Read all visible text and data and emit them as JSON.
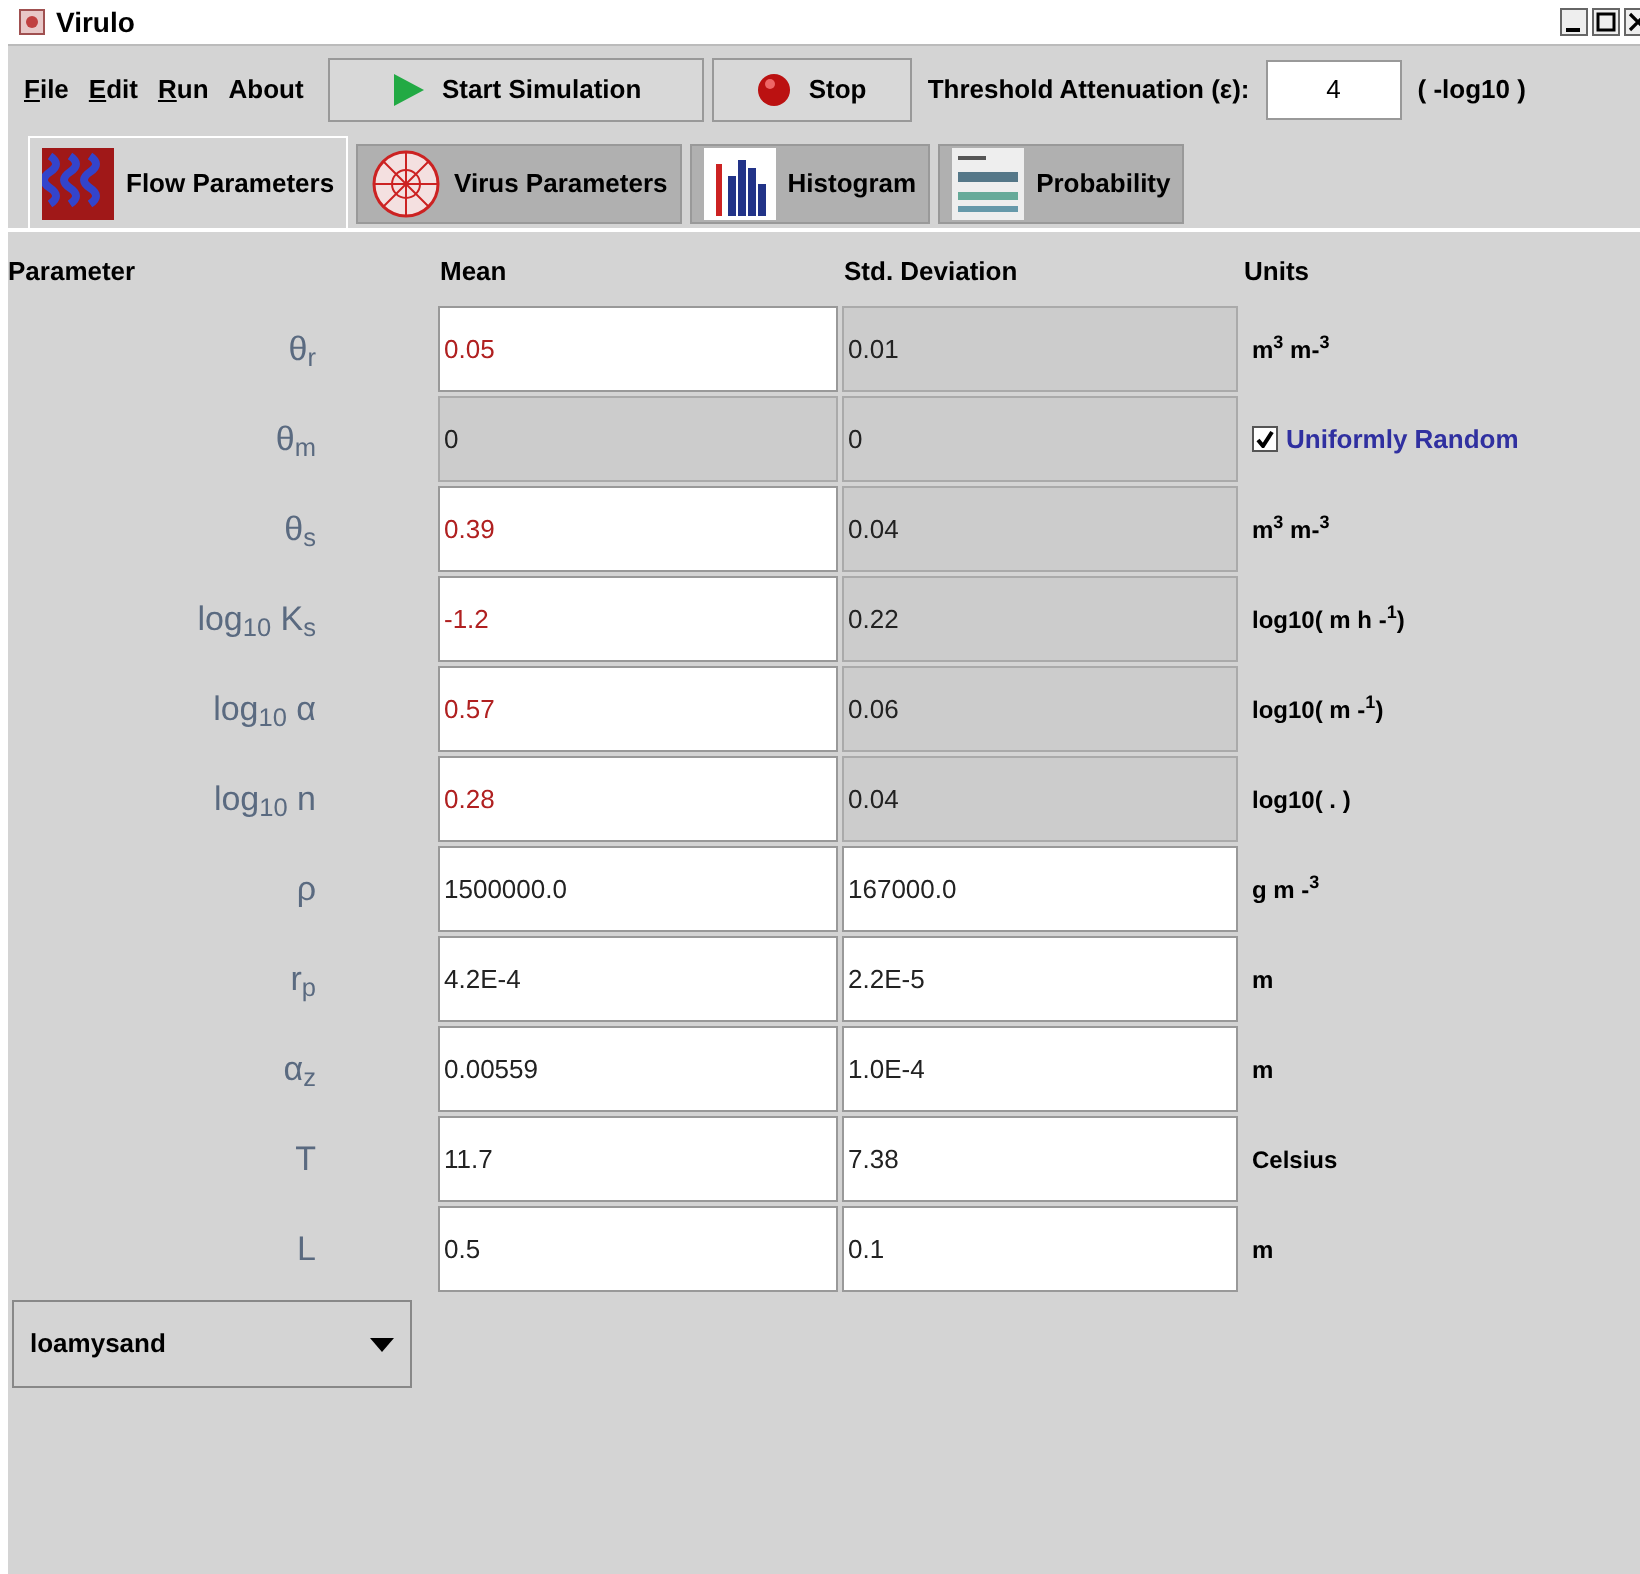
{
  "window": {
    "title": "Virulo"
  },
  "menu": [
    {
      "label": "File",
      "mnemonic": true
    },
    {
      "label": "Edit",
      "mnemonic": true
    },
    {
      "label": "Run",
      "mnemonic": true
    },
    {
      "label": "About",
      "mnemonic": false
    }
  ],
  "toolbar": {
    "start_button": "Start Simulation",
    "stop_button": "Stop",
    "threshold_label": "Threshold Attenuation (ε):",
    "threshold_value": "4",
    "threshold_unit": "( -log10 )"
  },
  "tabs": [
    {
      "label": "Flow Parameters",
      "selected": true,
      "kind": "waves"
    },
    {
      "label": "Virus Parameters",
      "selected": false,
      "kind": "virus"
    },
    {
      "label": "Histogram",
      "selected": false,
      "kind": "histogram"
    },
    {
      "label": "Probability",
      "selected": false,
      "kind": "table"
    }
  ],
  "table": {
    "columns": [
      "Parameter",
      "Mean",
      "Std. Deviation",
      "Units"
    ],
    "rows": [
      {
        "parameter": "θ$_{r}$",
        "mean": {
          "value": "0.05",
          "disabled": false,
          "highlighted": true
        },
        "std": {
          "value": "0.01",
          "disabled": true
        },
        "units": {
          "kind": "text",
          "text": "m$^{3}$ m-$^{3}$"
        }
      },
      {
        "parameter": "θ$_{m}$",
        "mean": {
          "value": "0",
          "disabled": true,
          "highlighted": false
        },
        "std": {
          "value": "0",
          "disabled": true
        },
        "units": {
          "kind": "checkbox",
          "text": "Uniformly Random",
          "checked": true
        }
      },
      {
        "parameter": "θ$_{s}$",
        "mean": {
          "value": "0.39",
          "disabled": false,
          "highlighted": true
        },
        "std": {
          "value": "0.04",
          "disabled": true
        },
        "units": {
          "kind": "text",
          "text": "m$^{3}$ m-$^{3}$"
        }
      },
      {
        "parameter": "log$_{10}$ K$_{s}$",
        "mean": {
          "value": "-1.2",
          "disabled": false,
          "highlighted": true
        },
        "std": {
          "value": "0.22",
          "disabled": true
        },
        "units": {
          "kind": "text",
          "text": "log10( m h -$^{1}$)"
        }
      },
      {
        "parameter": "log$_{10}$ α",
        "mean": {
          "value": "0.57",
          "disabled": false,
          "highlighted": true
        },
        "std": {
          "value": "0.06",
          "disabled": true
        },
        "units": {
          "kind": "text",
          "text": "log10( m -$^{1}$)"
        }
      },
      {
        "parameter": "log$_{10}$ n",
        "mean": {
          "value": "0.28",
          "disabled": false,
          "highlighted": true
        },
        "std": {
          "value": "0.04",
          "disabled": true
        },
        "units": {
          "kind": "text",
          "text": "log10( . )"
        }
      },
      {
        "parameter": "ρ",
        "mean": {
          "value": "1500000.0",
          "disabled": false,
          "highlighted": false
        },
        "std": {
          "value": "167000.0",
          "disabled": false
        },
        "units": {
          "kind": "text",
          "text": "g m -$^{3}$"
        }
      },
      {
        "parameter": "r$_{p}$",
        "mean": {
          "value": "4.2E-4",
          "disabled": false,
          "highlighted": false
        },
        "std": {
          "value": "2.2E-5",
          "disabled": false
        },
        "units": {
          "kind": "text",
          "text": "m"
        }
      },
      {
        "parameter": "α$_{z}$",
        "mean": {
          "value": "0.00559",
          "disabled": false,
          "highlighted": false
        },
        "std": {
          "value": "1.0E-4",
          "disabled": false
        },
        "units": {
          "kind": "text",
          "text": "m"
        }
      },
      {
        "parameter": "T",
        "mean": {
          "value": "11.7",
          "disabled": false,
          "highlighted": false
        },
        "std": {
          "value": "7.38",
          "disabled": false
        },
        "units": {
          "kind": "text",
          "text": "Celsius"
        }
      },
      {
        "parameter": "L",
        "mean": {
          "value": "0.5",
          "disabled": false,
          "highlighted": false
        },
        "std": {
          "value": "0.1",
          "disabled": false
        },
        "units": {
          "kind": "text",
          "text": "m"
        }
      }
    ]
  },
  "soil_type": {
    "value": "loamysand"
  }
}
